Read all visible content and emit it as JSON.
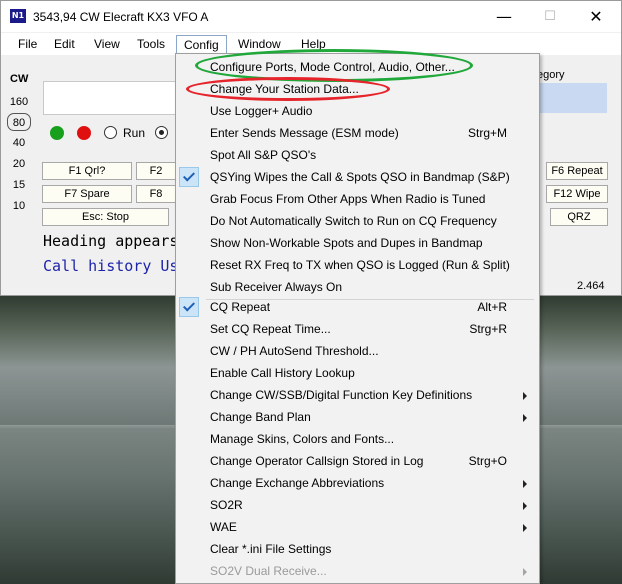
{
  "window": {
    "icon_text": "N1",
    "title": "3543,94 CW Elecraft KX3 VFO A"
  },
  "menubar": {
    "items": [
      "File",
      "Edit",
      "View",
      "Tools",
      "Config",
      "Window",
      "Help"
    ]
  },
  "mode": "CW",
  "bands": [
    "160",
    "80",
    "40",
    "20",
    "15",
    "10"
  ],
  "selected_band": "80",
  "category_label": "egory",
  "run_label": "Run",
  "fkeys": {
    "f1": "F1 Qrl?",
    "f2": "F2",
    "f6": "F6 Repeat",
    "f7": "F7 Spare",
    "f8": "F8",
    "f12": "F12 Wipe",
    "esc": "Esc: Stop",
    "qrz": "QRZ"
  },
  "status": {
    "heading": "Heading appears",
    "call_history": "Call history Us",
    "version": "2.464"
  },
  "config_menu": {
    "items": [
      {
        "label": "Configure Ports, Mode Control, Audio, Other..."
      },
      {
        "label": "Change Your Station Data..."
      },
      {
        "label": "Use Logger+ Audio"
      },
      {
        "label": "Enter Sends Message (ESM mode)",
        "shortcut": "Strg+M"
      },
      {
        "label": "Spot All S&P QSO's"
      },
      {
        "label": "QSYing Wipes the Call & Spots QSO in Bandmap (S&P)",
        "checked": true
      },
      {
        "label": "Grab Focus From Other Apps When Radio is Tuned"
      },
      {
        "label": "Do Not Automatically Switch to Run on CQ Frequency"
      },
      {
        "label": "Show Non-Workable Spots and Dupes in Bandmap"
      },
      {
        "label": "Reset RX Freq to TX when QSO is Logged (Run & Split)"
      },
      {
        "label": "Sub Receiver Always On"
      },
      {
        "label": "CQ Repeat",
        "shortcut": "Alt+R",
        "checked": true
      },
      {
        "label": "Set CQ Repeat Time...",
        "shortcut": "Strg+R"
      },
      {
        "label": "CW / PH AutoSend Threshold..."
      },
      {
        "label": "Enable Call History Lookup"
      },
      {
        "label": "Change CW/SSB/Digital Function Key Definitions",
        "submenu": true
      },
      {
        "label": "Change Band Plan",
        "submenu": true
      },
      {
        "label": "Manage Skins, Colors and Fonts..."
      },
      {
        "label": "Change Operator Callsign Stored in Log",
        "shortcut": "Strg+O"
      },
      {
        "label": "Change Exchange Abbreviations",
        "submenu": true
      },
      {
        "label": "SO2R",
        "submenu": true
      },
      {
        "label": "WAE",
        "submenu": true
      },
      {
        "label": "Clear *.ini File Settings"
      },
      {
        "label": "SO2V Dual Receive...",
        "submenu": true,
        "disabled": true
      }
    ]
  },
  "annotations": {
    "green_highlight_color": "#21a83a",
    "red_highlight_color": "#e6242b"
  },
  "colors": {
    "menu_background": "#f2f2f2",
    "check_background": "#cce4f7",
    "call_history_text": "#1e24a8"
  }
}
